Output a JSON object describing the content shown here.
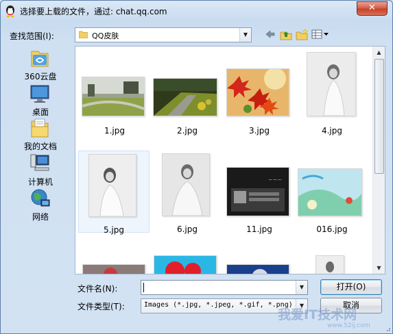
{
  "window": {
    "title": "选择要上载的文件，通过: chat.qq.com",
    "close_label": "✕"
  },
  "toolbar": {
    "lookin_label": "查找范围(I):",
    "lookin_value": "QQ皮肤",
    "back_icon": "back-arrow-icon",
    "up_icon": "up-folder-icon",
    "newfolder_icon": "new-folder-icon",
    "views_icon": "view-menu-icon"
  },
  "places": [
    {
      "label": "360云盘",
      "icon": "cloud-drive-icon"
    },
    {
      "label": "桌面",
      "icon": "desktop-icon"
    },
    {
      "label": "我的文档",
      "icon": "documents-icon"
    },
    {
      "label": "计算机",
      "icon": "computer-icon"
    },
    {
      "label": "网络",
      "icon": "network-icon"
    }
  ],
  "files": [
    {
      "name": "1.jpg",
      "selected": false
    },
    {
      "name": "2.jpg",
      "selected": false
    },
    {
      "name": "3.jpg",
      "selected": false
    },
    {
      "name": "4.jpg",
      "selected": false
    },
    {
      "name": "5.jpg",
      "selected": true
    },
    {
      "name": "6.jpg",
      "selected": false
    },
    {
      "name": "11.jpg",
      "selected": false
    },
    {
      "name": "016.jpg",
      "selected": false
    }
  ],
  "footer": {
    "filename_label": "文件名(N):",
    "filename_value": "",
    "filetype_label": "文件类型(T):",
    "filetype_value": "Images (*.jpg, *.jpeg, *.gif, *.png)",
    "open_label": "打开(O)",
    "cancel_label": "取消"
  },
  "watermark": {
    "text": "我爱IT技术网",
    "sub": "www.52ij.com"
  }
}
